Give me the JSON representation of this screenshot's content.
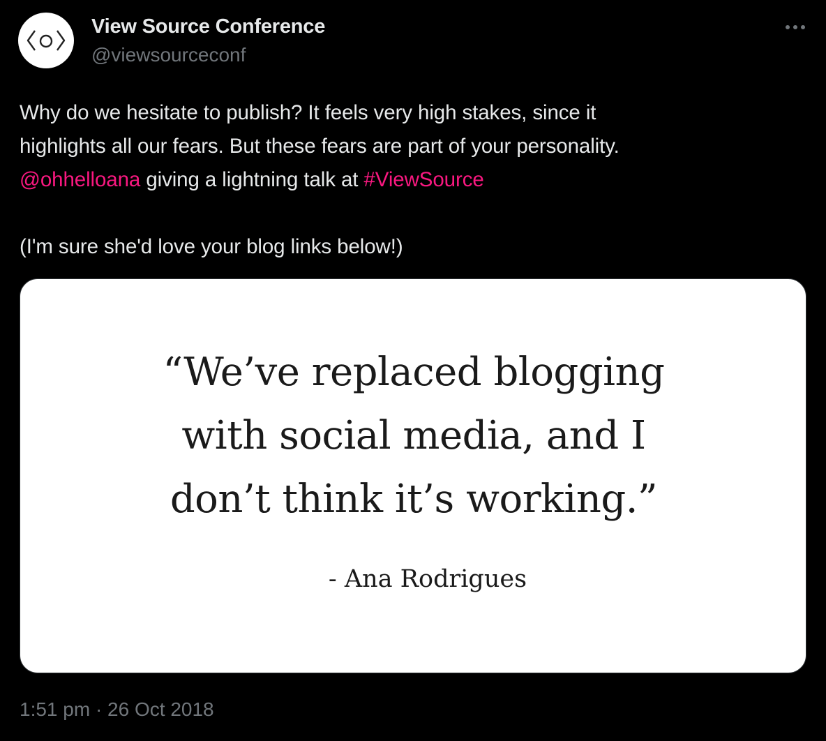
{
  "author": {
    "display_name": "View Source Conference",
    "handle": "@viewsourceconf",
    "avatar_icon": "angle-brackets-circle-logo"
  },
  "more_icon": "ellipsis-icon",
  "tweet": {
    "line1": "Why do we hesitate to publish? It feels very high stakes, since it",
    "line2": "highlights all our fears. But these fears are part of your personality.",
    "mention": "@ohhelloana",
    "mid_text": " giving a lightning talk at ",
    "hashtag": "#ViewSource",
    "line4": "(I'm sure she'd love your blog links below!)"
  },
  "media": {
    "quote_line1": "“We’ve replaced blogging",
    "quote_line2": "with social media, and I",
    "quote_line3": "don’t think it’s working.”",
    "attribution": "- Ana Rodrigues"
  },
  "timestamp": "1:51 pm · 26 Oct 2018",
  "colors": {
    "background": "#000000",
    "text": "#e7e9ea",
    "secondary": "#71767b",
    "link": "#f91880",
    "card": "#ffffff"
  }
}
